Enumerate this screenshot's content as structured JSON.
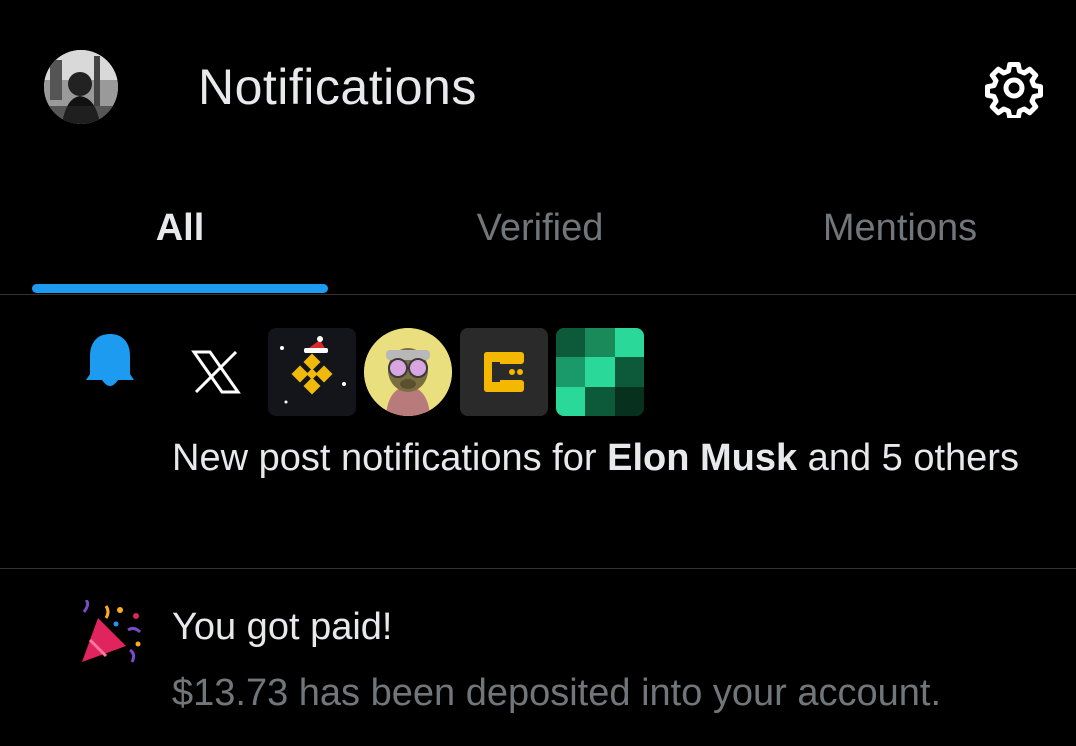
{
  "header": {
    "title": "Notifications",
    "avatar_icon": "user-avatar",
    "settings_icon": "gear-icon"
  },
  "tabs": [
    {
      "label": "All",
      "active": true
    },
    {
      "label": "Verified",
      "active": false
    },
    {
      "label": "Mentions",
      "active": false
    }
  ],
  "colors": {
    "background": "#000000",
    "accent": "#1d9bf0",
    "text_primary": "#e7e9ea",
    "text_secondary": "#71767b",
    "divider": "#2f3336"
  },
  "notifications": [
    {
      "type": "new-post",
      "icon": "bell-icon",
      "avatars": [
        "x-logo",
        "binance-logo",
        "ape-avatar",
        "yellow-pattern-logo",
        "green-grid-logo"
      ],
      "text_prefix": "New post notifications for ",
      "text_bold": "Elon Musk",
      "text_suffix": " and 5 others"
    },
    {
      "type": "payout",
      "icon": "party-popper-icon",
      "title": "You got paid!",
      "subtitle": "$13.73 has been deposited into your account."
    }
  ]
}
